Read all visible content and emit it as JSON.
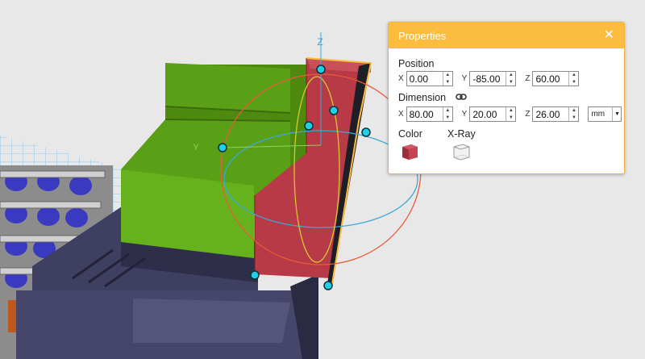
{
  "viewport": {
    "axis_labels": {
      "z": "Z",
      "y": "Y"
    }
  },
  "properties_panel": {
    "title": "Properties",
    "close_symbol": "✕",
    "position": {
      "label": "Position",
      "x": {
        "axis": "X",
        "value": "0.00"
      },
      "y": {
        "axis": "Y",
        "value": "-85.00"
      },
      "z": {
        "axis": "Z",
        "value": "60.00"
      }
    },
    "dimension": {
      "label": "Dimension",
      "link_icon": "link-icon",
      "x": {
        "axis": "X",
        "value": "80.00"
      },
      "y": {
        "axis": "Y",
        "value": "20.00"
      },
      "z": {
        "axis": "Z",
        "value": "26.00"
      },
      "unit": "mm"
    },
    "color": {
      "label": "Color",
      "value": "#b83a46",
      "icon": "cube-color-icon"
    },
    "xray": {
      "label": "X-Ray",
      "icon": "cube-xray-icon"
    }
  },
  "colors": {
    "accent": "#fcbc3d",
    "selected_box": "#b83a46",
    "green_block": "#5a9e12",
    "base_block": "#4a4a6e"
  }
}
